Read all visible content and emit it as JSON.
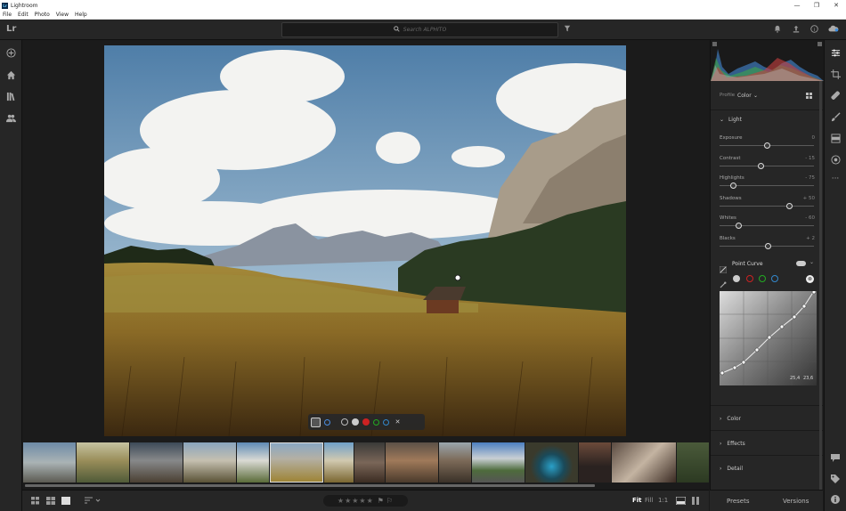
{
  "window": {
    "title": "Lightroom",
    "controls": [
      "—",
      "❐",
      "✕"
    ]
  },
  "menu": [
    "File",
    "Edit",
    "Photo",
    "View",
    "Help"
  ],
  "topbar": {
    "logo": "Lr",
    "search_placeholder": "Search ALPHITO"
  },
  "edit": {
    "profile_label": "Profile",
    "profile_value": "Color",
    "light_section": "Light",
    "sliders": [
      {
        "name": "Exposure",
        "value": "0",
        "pos": 0.5
      },
      {
        "name": "Contrast",
        "value": "- 15",
        "pos": 0.43
      },
      {
        "name": "Highlights",
        "value": "- 75",
        "pos": 0.14
      },
      {
        "name": "Shadows",
        "value": "+ 50",
        "pos": 0.74
      },
      {
        "name": "Whites",
        "value": "- 60",
        "pos": 0.2
      },
      {
        "name": "Blacks",
        "value": "+ 2",
        "pos": 0.51
      }
    ],
    "point_curve_label": "Point Curve",
    "curve_readout_1": "25,4",
    "curve_readout_2": "23,6",
    "sections": [
      "Color",
      "Effects",
      "Detail"
    ]
  },
  "bottom": {
    "rating_stars": "★★★★★",
    "view_fit": "Fit",
    "view_fill": "Fill",
    "view_1to1": "1:1"
  },
  "right_tabs": {
    "presets": "Presets",
    "versions": "Versions"
  }
}
